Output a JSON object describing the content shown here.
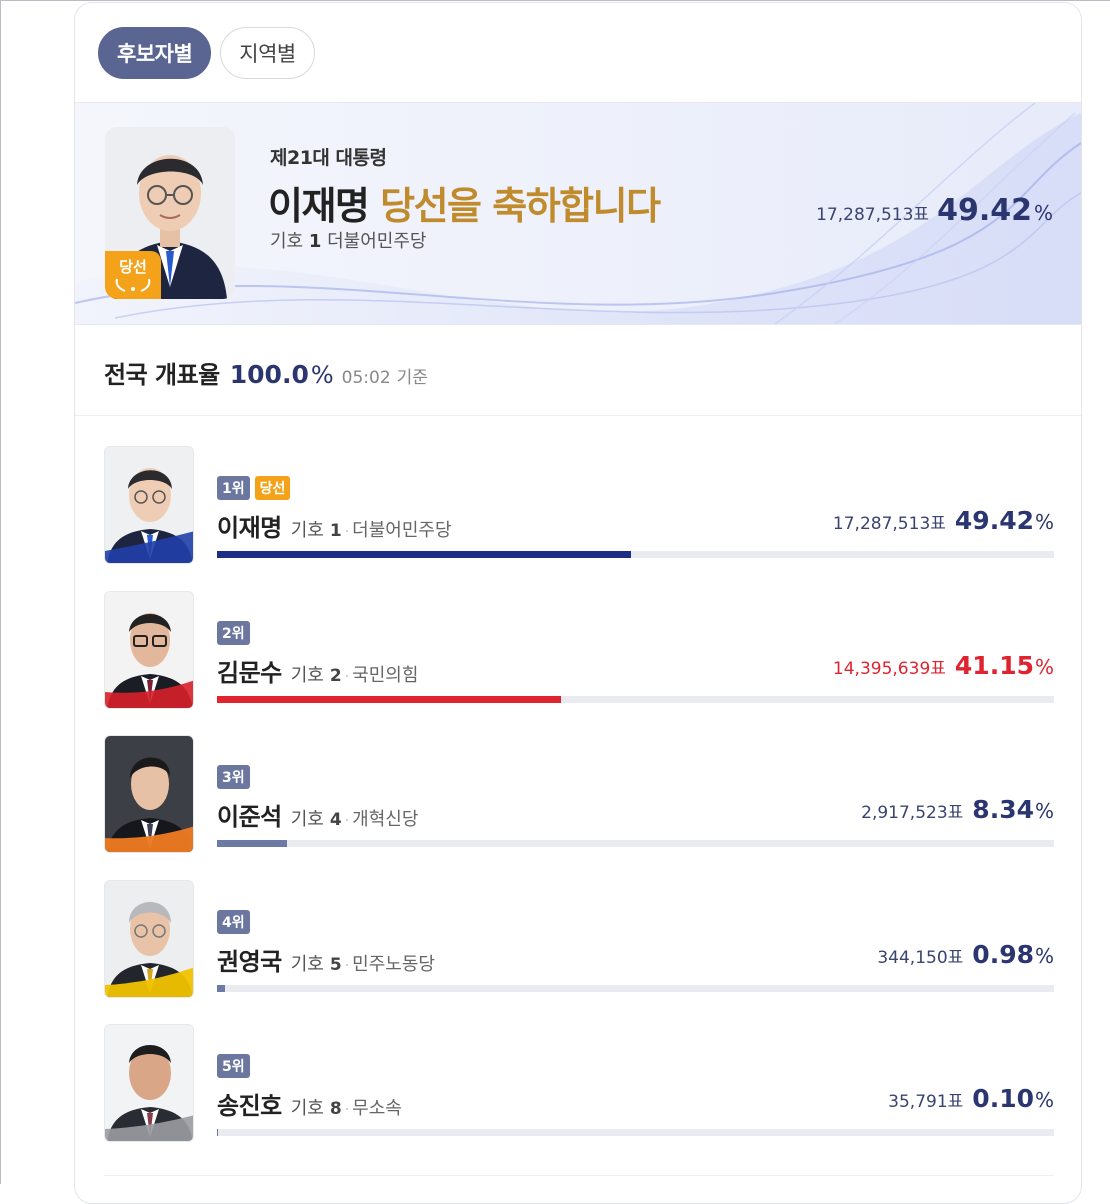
{
  "tabs": [
    {
      "label": "후보자별",
      "active": true
    },
    {
      "label": "지역별",
      "active": false
    }
  ],
  "banner": {
    "subtitle": "제21대 대통령",
    "winner_name": "이재명",
    "congrats": "당선을 축하합니다",
    "symbol_label": "기호",
    "symbol_number": "1",
    "party": "더불어민주당",
    "votes": "17,287,513표",
    "percent": "49.42",
    "percent_sign": "%",
    "elected_badge": "당선"
  },
  "turnout": {
    "label": "전국 개표율",
    "rate": "100.0",
    "percent_sign": "%",
    "time": "05:02",
    "reference": "기준"
  },
  "candidates": [
    {
      "rank": "1위",
      "elected": "당선",
      "name": "이재명",
      "symbol_label": "기호",
      "symbol_number": "1",
      "dot": "·",
      "party": "더불어민주당",
      "votes": "17,287,513표",
      "percent": "49.42",
      "percent_sign": "%",
      "share": 49.42,
      "bar_color": "#1e2d85",
      "ribbon_color": "#1f3fa8"
    },
    {
      "rank": "2위",
      "name": "김문수",
      "symbol_label": "기호",
      "symbol_number": "2",
      "dot": "·",
      "party": "국민의힘",
      "votes": "14,395,639표",
      "percent": "41.15",
      "percent_sign": "%",
      "share": 41.15,
      "bar_color": "#e0242f",
      "ribbon_color": "#d8202b"
    },
    {
      "rank": "3위",
      "name": "이준석",
      "symbol_label": "기호",
      "symbol_number": "4",
      "dot": "·",
      "party": "개혁신당",
      "votes": "2,917,523표",
      "percent": "8.34",
      "percent_sign": "%",
      "share": 8.34,
      "bar_color": "#6d7aa3",
      "ribbon_color": "#f07b22"
    },
    {
      "rank": "4위",
      "name": "권영국",
      "symbol_label": "기호",
      "symbol_number": "5",
      "dot": "·",
      "party": "민주노동당",
      "votes": "344,150표",
      "percent": "0.98",
      "percent_sign": "%",
      "share": 0.98,
      "bar_color": "#6d7aa3",
      "ribbon_color": "#f2c200"
    },
    {
      "rank": "5위",
      "name": "송진호",
      "symbol_label": "기호",
      "symbol_number": "8",
      "dot": "·",
      "party": "무소속",
      "votes": "35,791표",
      "percent": "0.10",
      "percent_sign": "%",
      "share": 0.1,
      "bar_color": "#6d7aa3",
      "ribbon_color": "#9a9ca2"
    }
  ]
}
